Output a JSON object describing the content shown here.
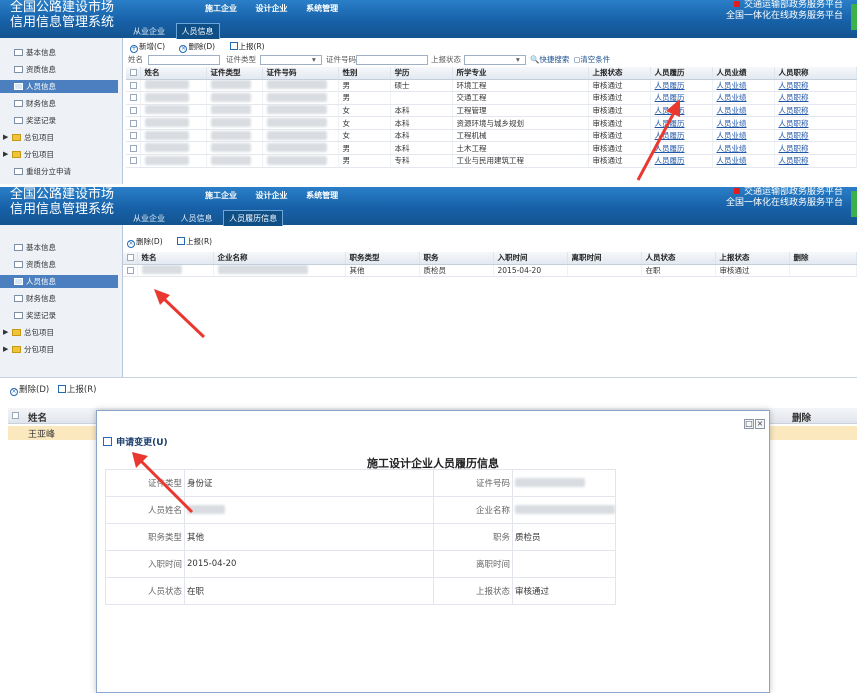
{
  "app": {
    "title": "全国公路建设市场信用信息管理系统",
    "nav": [
      "施工企业",
      "设计企业",
      "系统管理"
    ],
    "gov_line1": "交通运输部政务服务平台",
    "gov_line2": "全国一体化在线政务服务平台"
  },
  "panel1": {
    "tabs": [
      "从业企业",
      "人员信息"
    ],
    "sidebar": [
      "基本信息",
      "资质信息",
      "人员信息",
      "财务信息",
      "奖惩记录",
      "总包项目",
      "分包项目",
      "重组分立申请"
    ],
    "toolbar": [
      "新增(C)",
      "删除(D)",
      "上报(R)"
    ],
    "search": {
      "name": "姓名",
      "id_type": "证件类型",
      "id_no": "证件号码",
      "status": "上报状态",
      "quick": "快捷搜索",
      "clear": "清空条件"
    },
    "columns": [
      "姓名",
      "证件类型",
      "证件号码",
      "性别",
      "学历",
      "所学专业",
      "上报状态",
      "人员履历",
      "人员业绩",
      "人员职称"
    ],
    "rows": [
      {
        "gender": "男",
        "edu": "硕士",
        "major": "环境工程",
        "status": "审核通过",
        "l1": "人员履历",
        "l2": "人员业绩",
        "l3": "人员职称"
      },
      {
        "gender": "男",
        "edu": "",
        "major": "交通工程",
        "status": "审核通过",
        "l1": "人员履历",
        "l2": "人员业绩",
        "l3": "人员职称"
      },
      {
        "gender": "女",
        "edu": "本科",
        "major": "工程管理",
        "status": "审核通过",
        "l1": "人员履历",
        "l2": "人员业绩",
        "l3": "人员职称"
      },
      {
        "gender": "女",
        "edu": "本科",
        "major": "资源环境与城乡规划",
        "status": "审核通过",
        "l1": "人员履历",
        "l2": "人员业绩",
        "l3": "人员职称"
      },
      {
        "gender": "女",
        "edu": "本科",
        "major": "工程机械",
        "status": "审核通过",
        "l1": "人员履历",
        "l2": "人员业绩",
        "l3": "人员职称"
      },
      {
        "gender": "男",
        "edu": "本科",
        "major": "土木工程",
        "status": "审核通过",
        "l1": "人员履历",
        "l2": "人员业绩",
        "l3": "人员职称"
      },
      {
        "gender": "男",
        "edu": "专科",
        "major": "工业与民用建筑工程",
        "status": "审核通过",
        "l1": "人员履历",
        "l2": "人员业绩",
        "l3": "人员职称"
      }
    ]
  },
  "panel2": {
    "tabs": [
      "从业企业",
      "人员信息",
      "人员履历信息"
    ],
    "sidebar": [
      "基本信息",
      "资质信息",
      "人员信息",
      "财务信息",
      "奖惩记录",
      "总包项目",
      "分包项目"
    ],
    "toolbar": [
      "删除(D)",
      "上报(R)"
    ],
    "columns": [
      "姓名",
      "企业名称",
      "职务类型",
      "职务",
      "入职时间",
      "离职时间",
      "人员状态",
      "上报状态",
      "删除"
    ],
    "row": {
      "job_type": "其他",
      "post": "质检员",
      "start": "2015-04-20",
      "end": "",
      "state": "在职",
      "report": "审核通过",
      "del": ""
    }
  },
  "panel3": {
    "toolbar": [
      "删除(D)",
      "上报(R)"
    ],
    "columns": [
      "姓名",
      "删除"
    ],
    "row_name": "王亚峰",
    "modal": {
      "action": "申请变更(U)",
      "title": "施工设计企业人员履历信息",
      "fields": [
        {
          "k": "证件类型",
          "v": "身份证",
          "k2": "证件号码",
          "v2": ""
        },
        {
          "k": "人员姓名",
          "v": "",
          "k2": "企业名称",
          "v2": ""
        },
        {
          "k": "职务类型",
          "v": "其他",
          "k2": "职务",
          "v2": "质检员"
        },
        {
          "k": "入职时间",
          "v": "2015-04-20",
          "k2": "离职时间",
          "v2": ""
        },
        {
          "k": "人员状态",
          "v": "在职",
          "k2": "上报状态",
          "v2": "审核通过"
        }
      ]
    }
  },
  "colors": {
    "header": "#1761a8",
    "accent_arrow": "#e8382f",
    "link": "#1f56a8"
  }
}
